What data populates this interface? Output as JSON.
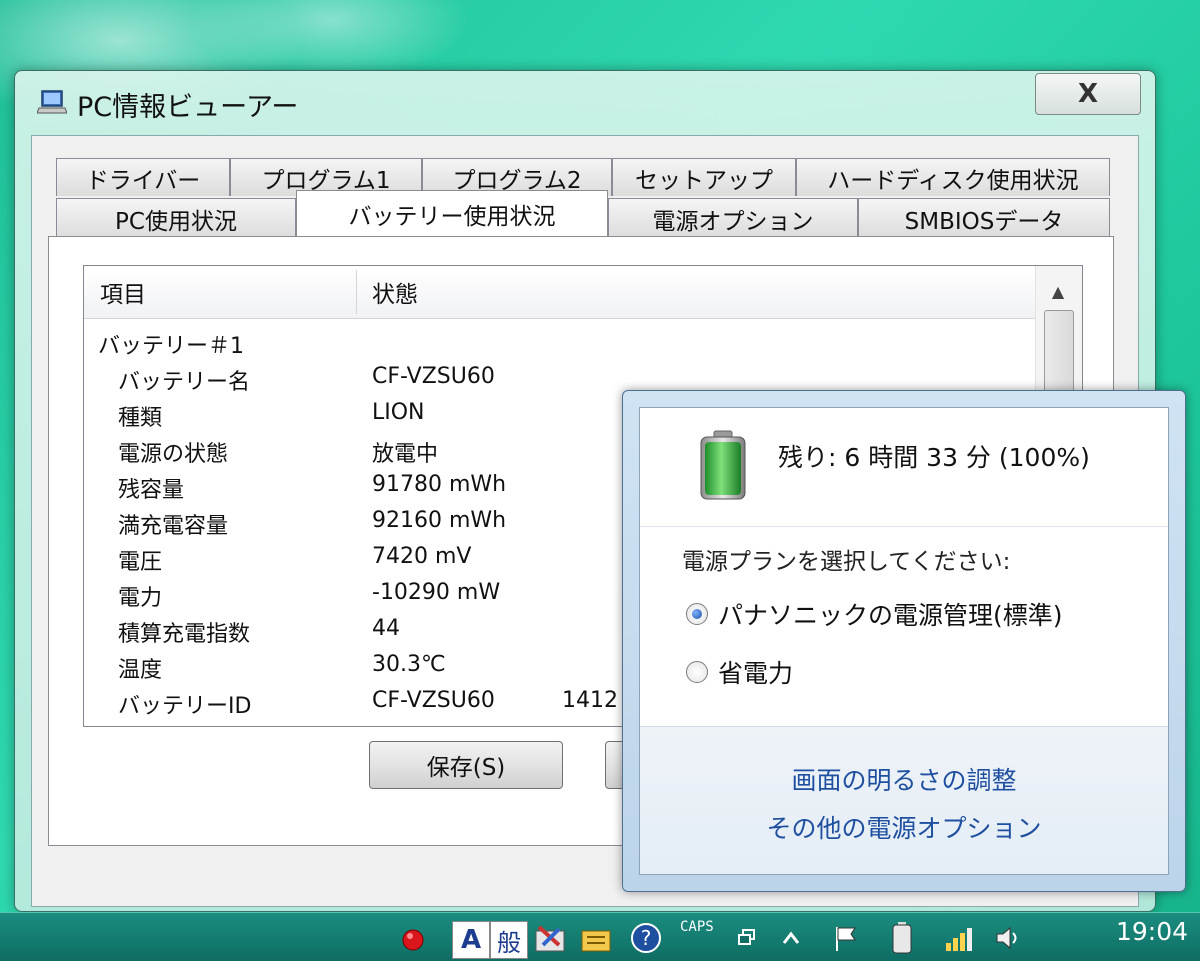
{
  "window": {
    "title": "PC情報ビューアー",
    "close_label": "X"
  },
  "tabs": {
    "row1": [
      "ドライバー",
      "プログラム1",
      "プログラム2",
      "セットアップ",
      "ハードディスク使用状況"
    ],
    "row2": [
      "PC使用状況",
      "バッテリー使用状況",
      "電源オプション",
      "SMBIOSデータ"
    ],
    "active": "バッテリー使用状況"
  },
  "list": {
    "col_item": "項目",
    "col_status": "状態",
    "group": "バッテリー＃1",
    "rows": [
      {
        "item": "バッテリー名",
        "status": "CF-VZSU60"
      },
      {
        "item": "種類",
        "status": "LION"
      },
      {
        "item": "電源の状態",
        "status": "放電中"
      },
      {
        "item": "残容量",
        "status": "91780 mWh"
      },
      {
        "item": "満充電容量",
        "status": "92160 mWh"
      },
      {
        "item": "電圧",
        "status": "7420 mV"
      },
      {
        "item": "電力",
        "status": "-10290 mW"
      },
      {
        "item": "積算充電指数",
        "status": "44"
      },
      {
        "item": "温度",
        "status": "30.3℃"
      },
      {
        "item": "バッテリーID",
        "status": "CF-VZSU60",
        "extra": "1412"
      }
    ]
  },
  "buttons": {
    "save": "保存(S)"
  },
  "flyout": {
    "remaining": "残り: 6 時間 33 分 (100%)",
    "battery_level": 1.0,
    "plan_prompt": "電源プランを選択してください:",
    "plans": [
      {
        "label": "パナソニックの電源管理(標準)",
        "selected": true
      },
      {
        "label": "省電力",
        "selected": false
      }
    ],
    "link_brightness": "画面の明るさの調整",
    "link_more": "その他の電源オプション"
  },
  "taskbar": {
    "ime_mode": "A",
    "ime_kanji": "般",
    "caps": "CAPS",
    "clock": "19:04"
  },
  "colors": {
    "desktop": "#1fbf98",
    "link": "#1f4fa0",
    "battery_green": "#39b54a"
  }
}
